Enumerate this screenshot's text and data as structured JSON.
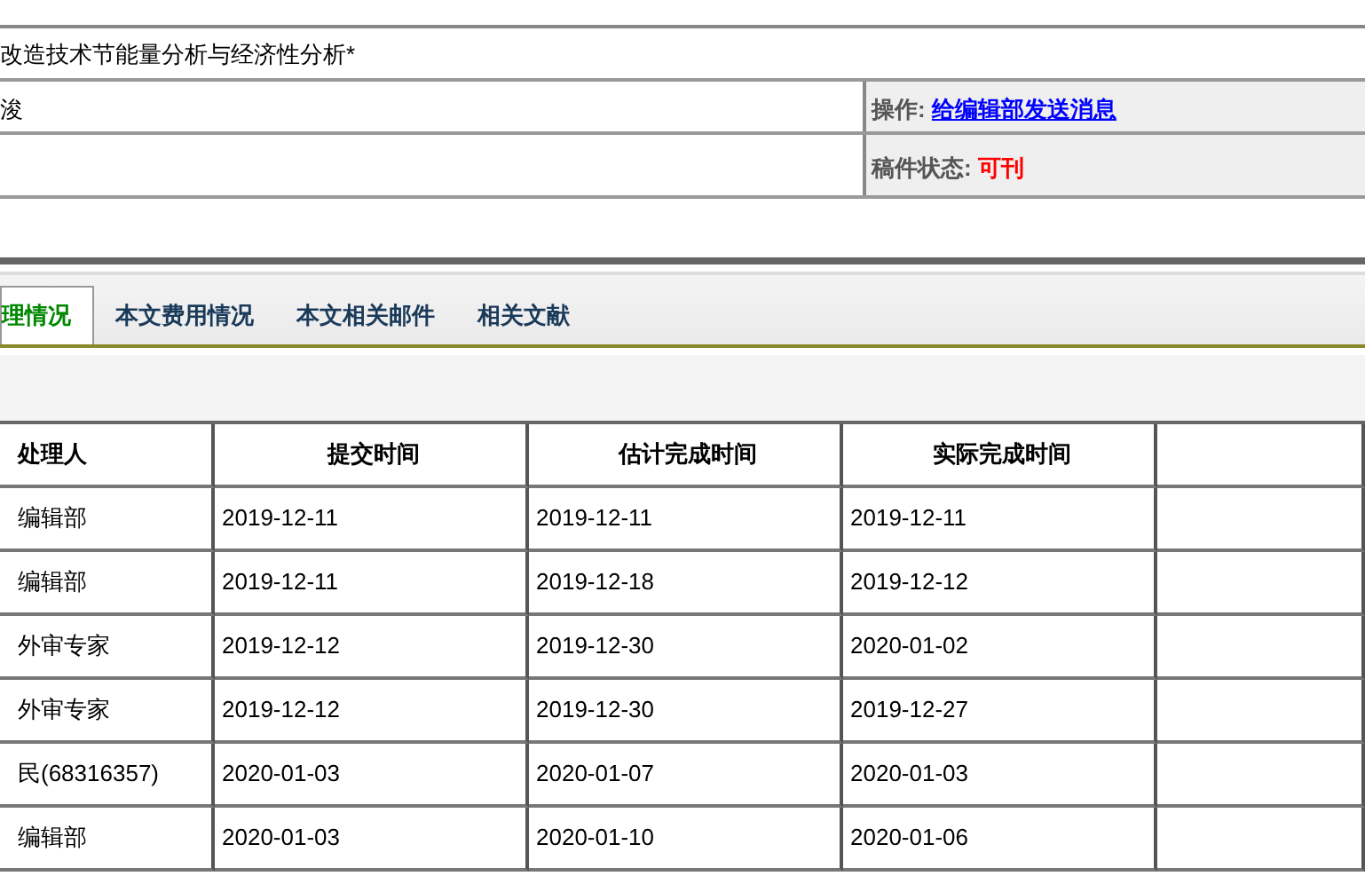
{
  "info": {
    "title": "改造技术节能量分析与经济性分析*",
    "author": "浚",
    "operation_label": "操作:",
    "operation_link": "给编辑部发送消息",
    "status_label": "稿件状态:",
    "status_value": "可刊"
  },
  "tabs": [
    {
      "label": "理情况",
      "selected": true
    },
    {
      "label": "本文费用情况",
      "selected": false
    },
    {
      "label": "本文相关邮件",
      "selected": false
    },
    {
      "label": "相关文献",
      "selected": false
    }
  ],
  "table": {
    "columns": [
      "处理人",
      "提交时间",
      "估计完成时间",
      "实际完成时间"
    ],
    "rows": [
      [
        "编辑部",
        "2019-12-11",
        "2019-12-11",
        "2019-12-11"
      ],
      [
        "编辑部",
        "2019-12-11",
        "2019-12-18",
        "2019-12-12"
      ],
      [
        "外审专家",
        "2019-12-12",
        "2019-12-30",
        "2020-01-02"
      ],
      [
        "外审专家",
        "2019-12-12",
        "2019-12-30",
        "2019-12-27"
      ],
      [
        "民(68316357)",
        "2020-01-03",
        "2020-01-07",
        "2020-01-03"
      ],
      [
        "编辑部",
        "2020-01-03",
        "2020-01-10",
        "2020-01-06"
      ]
    ]
  }
}
